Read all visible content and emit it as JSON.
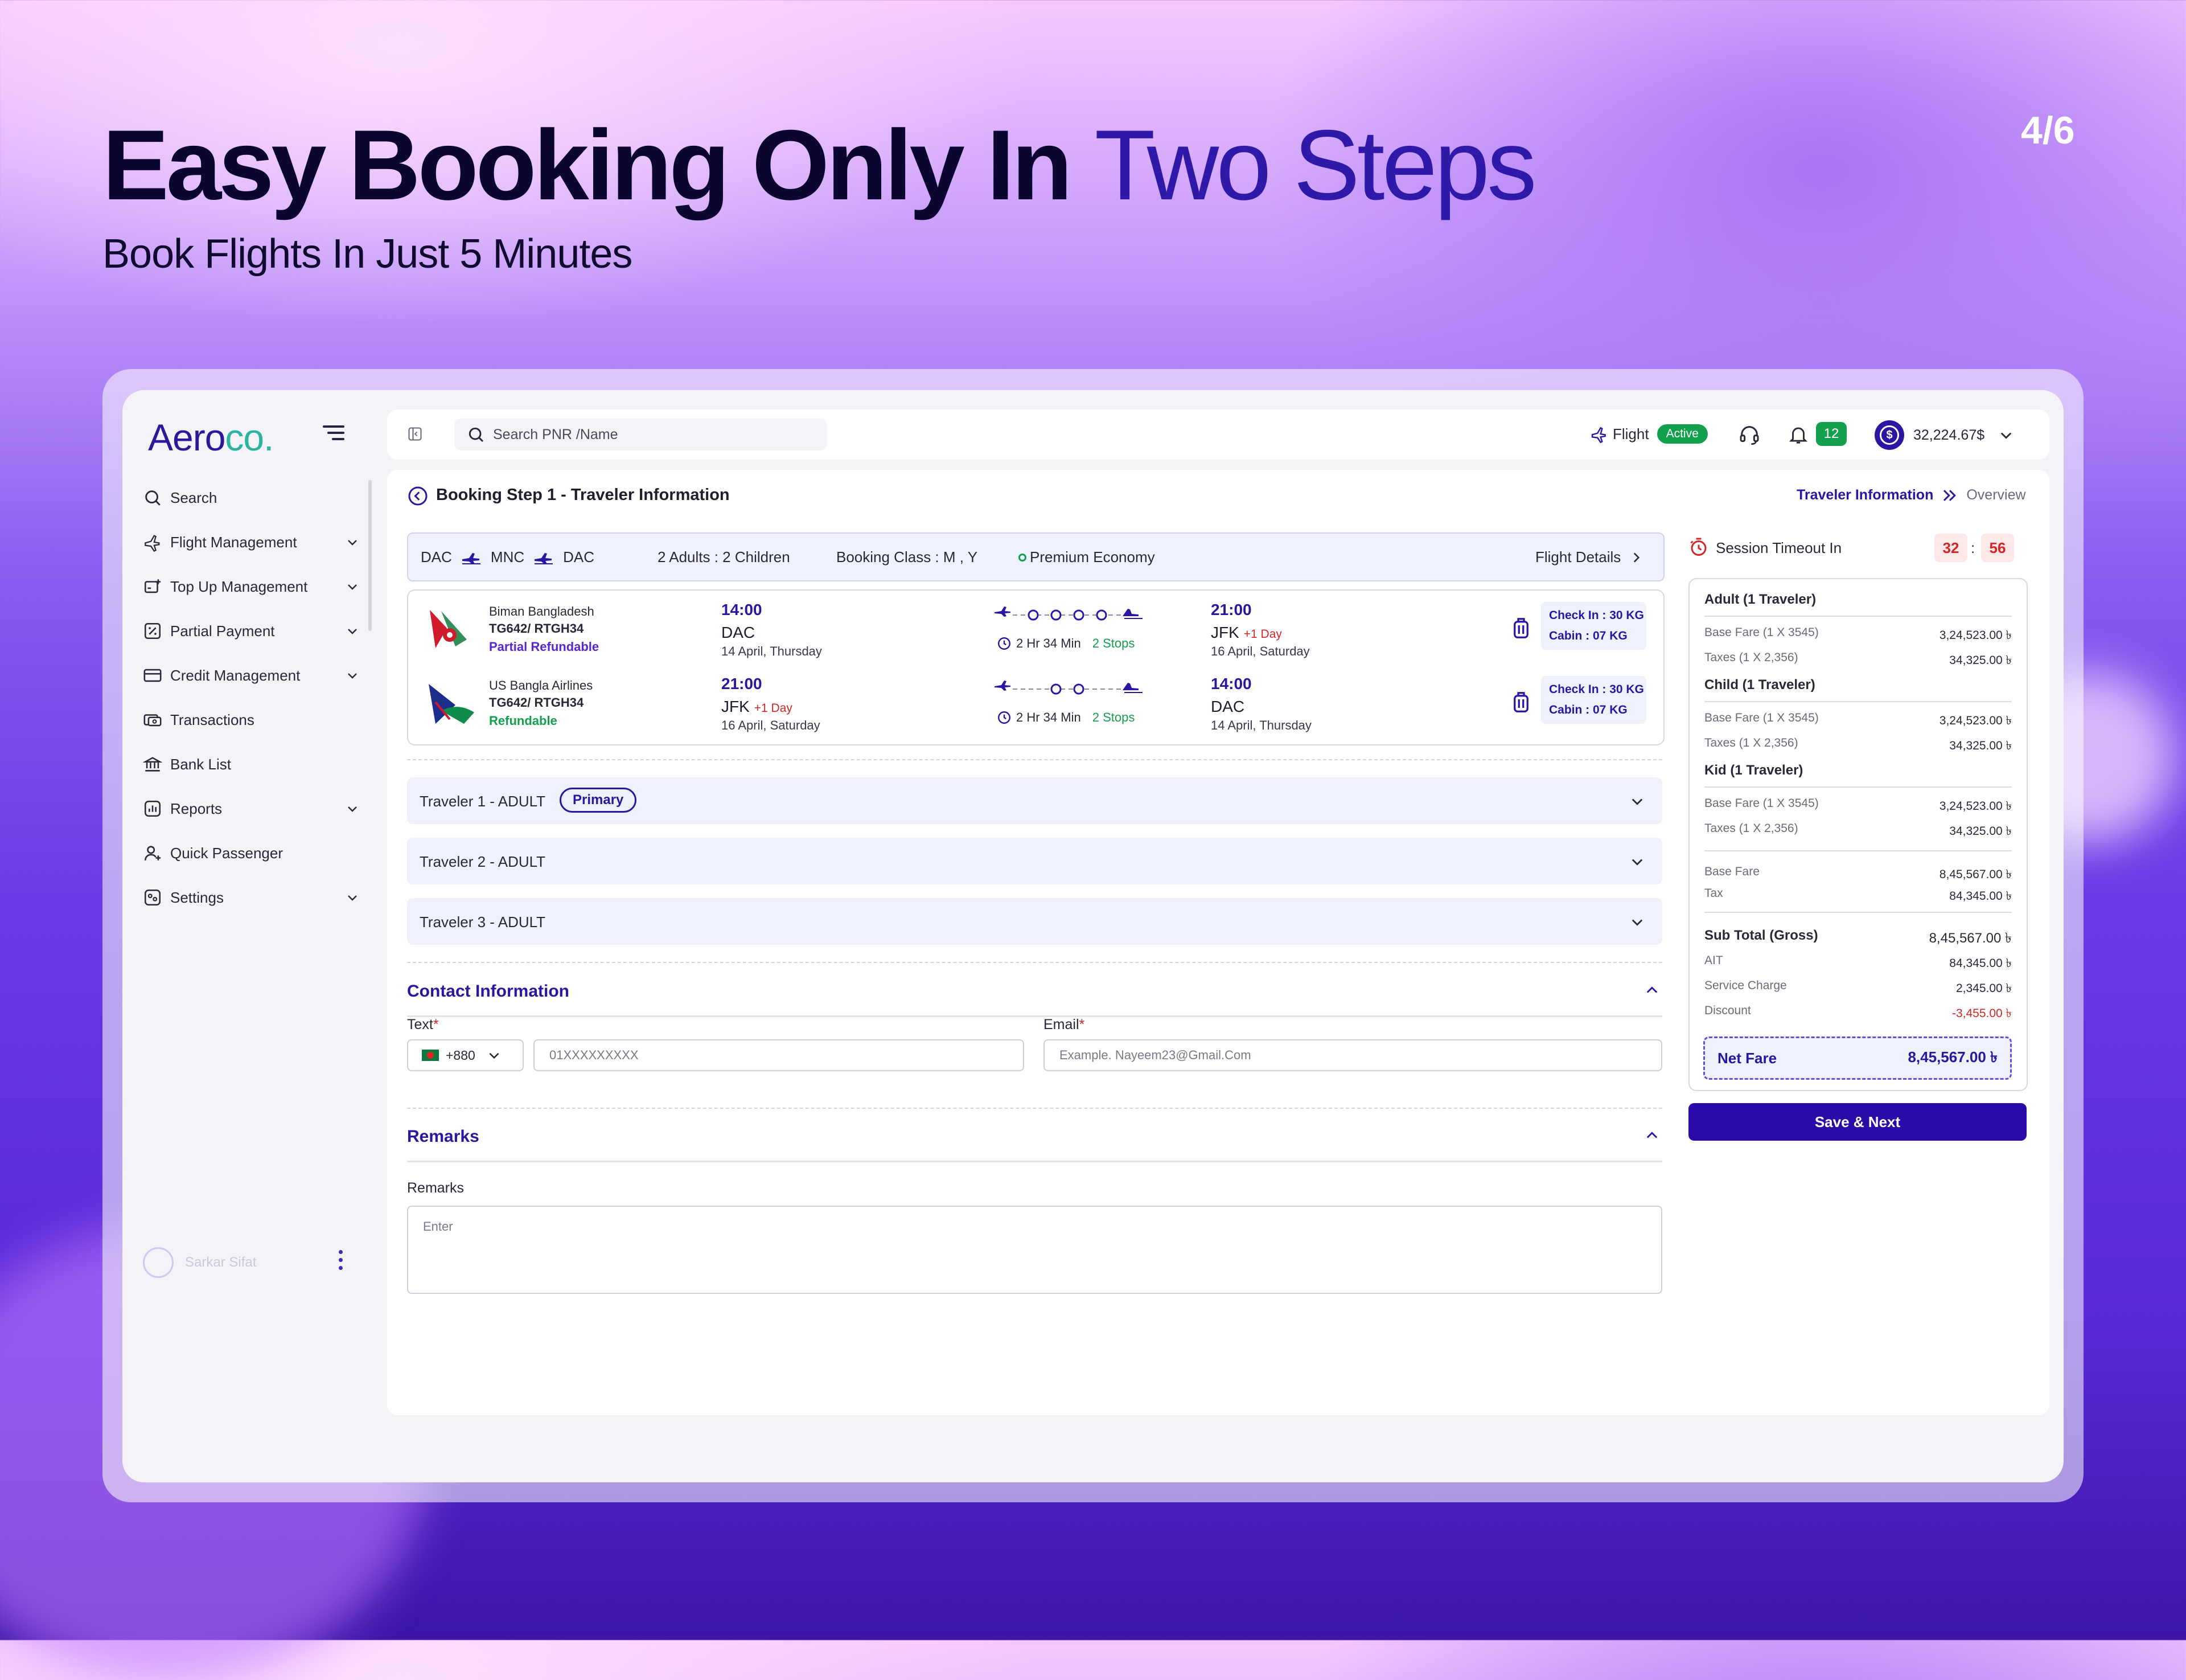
{
  "hero": {
    "title_bold": "Easy Booking Only In",
    "title_light": "Two Steps",
    "subtitle": "Book Flights In Just 5 Minutes",
    "pager": "4/6"
  },
  "sidebar": {
    "logo_main": "Aero",
    "logo_accent": "co",
    "logo_dot": ".",
    "items": [
      {
        "label": "Search",
        "icon": "search-icon",
        "has_children": false
      },
      {
        "label": "Flight Management",
        "icon": "plane-icon",
        "has_children": true
      },
      {
        "label": "Top Up Management",
        "icon": "topup-icon",
        "has_children": true
      },
      {
        "label": "Partial Payment",
        "icon": "percent-icon",
        "has_children": true
      },
      {
        "label": "Credit Management",
        "icon": "credit-card-icon",
        "has_children": true
      },
      {
        "label": "Transactions",
        "icon": "transactions-icon",
        "has_children": false
      },
      {
        "label": "Bank List",
        "icon": "bank-icon",
        "has_children": false
      },
      {
        "label": "Reports",
        "icon": "reports-icon",
        "has_children": true
      },
      {
        "label": "Quick Passenger",
        "icon": "add-user-icon",
        "has_children": false
      },
      {
        "label": "Settings",
        "icon": "settings-icon",
        "has_children": true
      }
    ],
    "user_name": "Sarkar Sifat"
  },
  "topbar": {
    "search_placeholder": "Search PNR /Name",
    "flight_label": "Flight",
    "flight_status": "Active",
    "notification_count": "12",
    "balance": "32,224.67$"
  },
  "page": {
    "title": "Booking Step 1 - Traveler Information",
    "breadcrumb_current": "Traveler Information",
    "breadcrumb_next": "Overview"
  },
  "route": {
    "from": "DAC",
    "via": "MNC",
    "to": "DAC",
    "passengers": "2 Adults : 2 Children",
    "booking_class": "Booking Class : M , Y",
    "cabin": "Premium Economy",
    "details_link": "Flight Details"
  },
  "flights": [
    {
      "airline": "Biman Bangladesh",
      "flight_no": "TG642/ RTGH34",
      "refund": "Partial Refundable",
      "dep_time": "14:00",
      "dep_code": "DAC",
      "dep_date": "14 April, Thursday",
      "duration": "2 Hr 34 Min",
      "stops": "2 Stops",
      "arr_time": "21:00",
      "arr_code": "JFK",
      "arr_extra": "+1 Day",
      "arr_date": "16 April, Saturday",
      "checkin": "Check In : 30 KG",
      "cabin_bag": "Cabin : 07 KG"
    },
    {
      "airline": "US Bangla Airlines",
      "flight_no": "TG642/ RTGH34",
      "refund": "Refundable",
      "dep_time": "21:00",
      "dep_code": "JFK",
      "dep_extra": "+1 Day",
      "dep_date": "16 April, Saturday",
      "duration": "2 Hr 34 Min",
      "stops": "2 Stops",
      "arr_time": "14:00",
      "arr_code": "DAC",
      "arr_date": "14 April, Thursday",
      "checkin": "Check In : 30 KG",
      "cabin_bag": "Cabin : 07 KG"
    }
  ],
  "travelers": [
    {
      "label": "Traveler 1 - ADULT",
      "badge": "Primary"
    },
    {
      "label": "Traveler 2 - ADULT"
    },
    {
      "label": "Traveler 3 - ADULT"
    }
  ],
  "contact": {
    "title": "Contact Information",
    "phone_label": "Text",
    "country_code": "+880",
    "phone_placeholder": "01XXXXXXXXX",
    "email_label": "Email",
    "email_placeholder": "Example. Nayeem23@Gmail.Com",
    "required_mark": "*"
  },
  "remarks": {
    "title": "Remarks",
    "label": "Remarks",
    "placeholder": "Enter"
  },
  "summary": {
    "session_label": "Session Timeout In",
    "session_min": "32",
    "session_sec": "56",
    "session_sep": ":",
    "groups": [
      {
        "title": "Adult (1 Traveler)",
        "rows": [
          [
            "Base Fare (1 X 3545)",
            "3,24,523.00 ৳"
          ],
          [
            "Taxes (1 X 2,356)",
            "34,325.00 ৳"
          ]
        ]
      },
      {
        "title": "Child (1 Traveler)",
        "rows": [
          [
            "Base Fare (1 X 3545)",
            "3,24,523.00 ৳"
          ],
          [
            "Taxes (1 X 2,356)",
            "34,325.00 ৳"
          ]
        ]
      },
      {
        "title": "Kid (1 Traveler)",
        "rows": [
          [
            "Base Fare (1 X 3545)",
            "3,24,523.00 ৳"
          ],
          [
            "Taxes (1 X 2,356)",
            "34,325.00 ৳"
          ]
        ]
      }
    ],
    "totals": [
      [
        "Base Fare",
        "8,45,567.00 ৳"
      ],
      [
        "Tax",
        "84,345.00 ৳"
      ]
    ],
    "subtotal": [
      "Sub Total (Gross)",
      "8,45,567.00 ৳"
    ],
    "adjustments": [
      [
        "AIT",
        "84,345.00 ৳"
      ],
      [
        "Service Charge",
        "2,345.00 ৳"
      ],
      [
        "Discount",
        "-3,455.00 ৳"
      ]
    ],
    "net_fare_label": "Net Fare",
    "net_fare_value": "8,45,567.00 ৳",
    "save_button": "Save & Next"
  },
  "colors": {
    "brand": "#2a16a3",
    "accent_green": "#12a04c",
    "danger": "#d32626",
    "logo_accent": "#2bb5a0"
  }
}
